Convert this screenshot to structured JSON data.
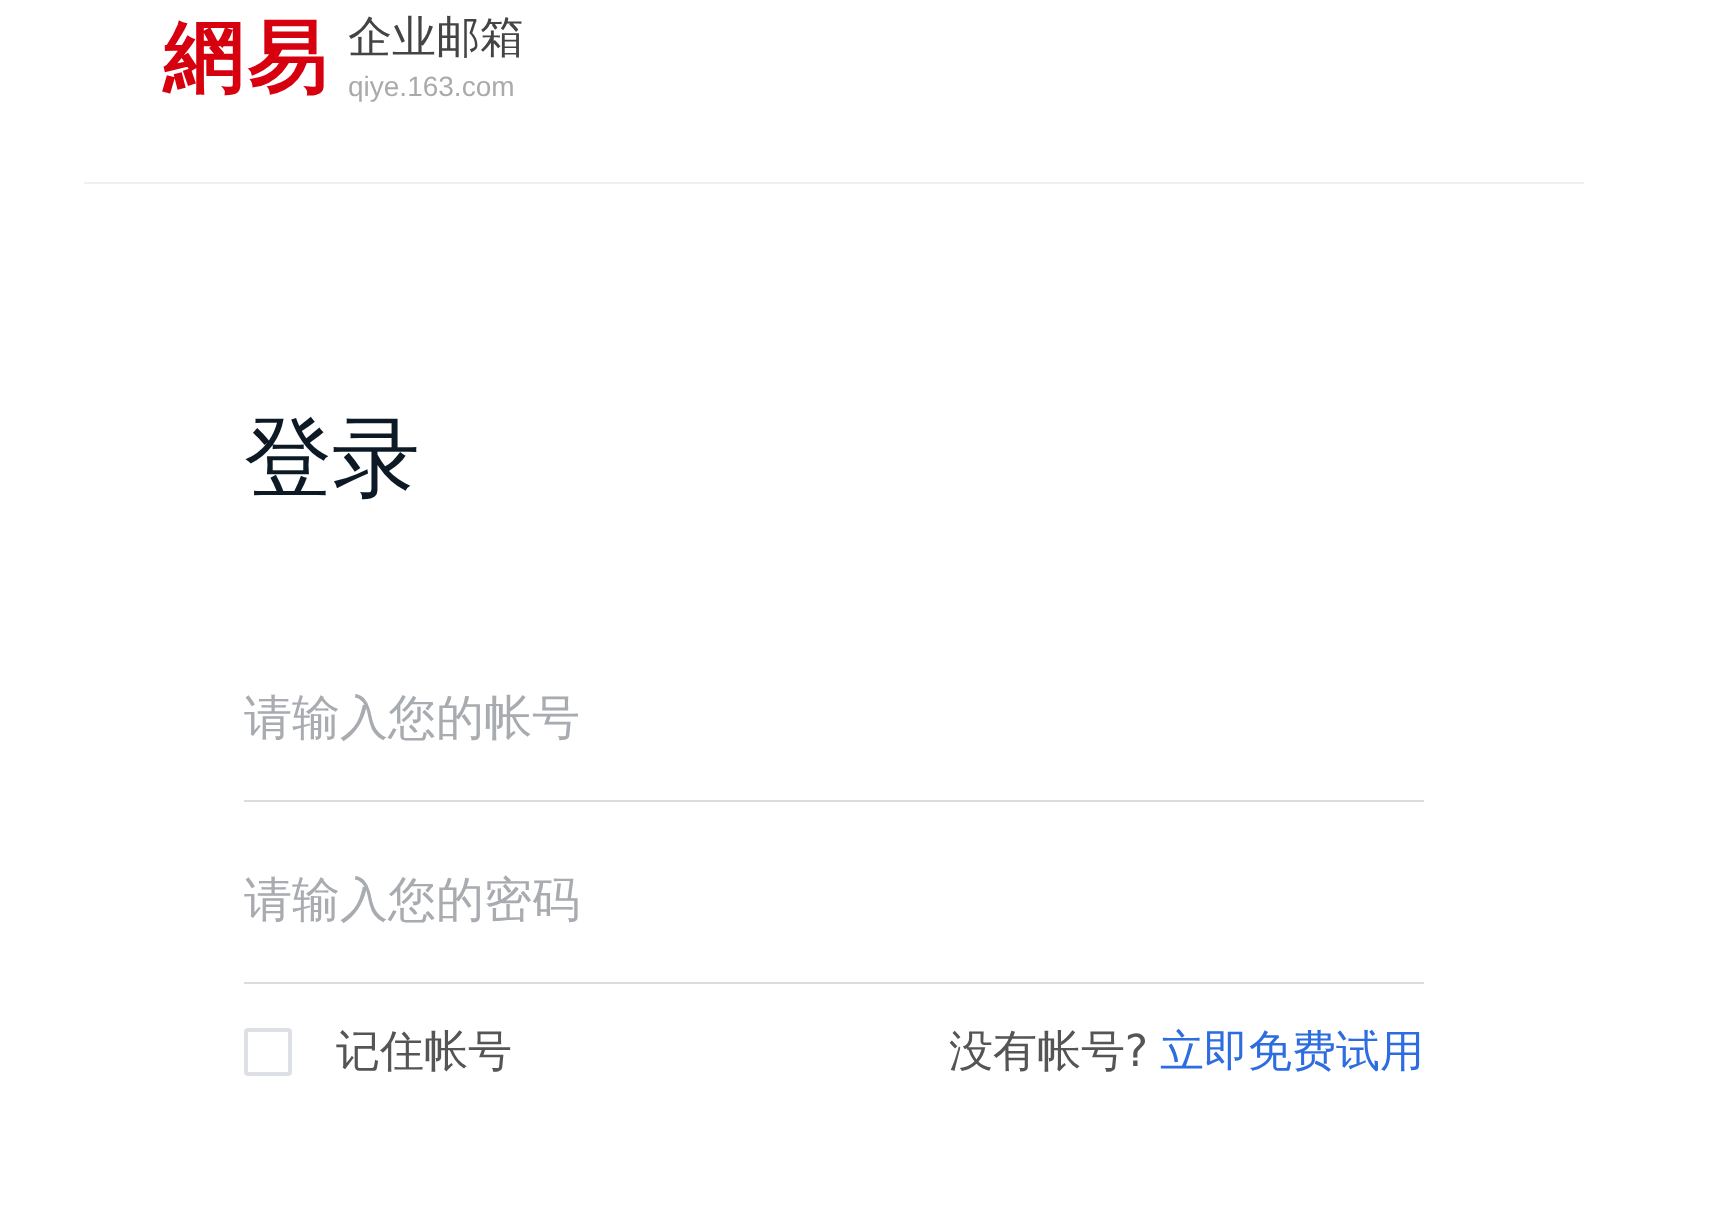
{
  "logo": {
    "mark": "網易",
    "name": "企业邮箱",
    "domain": "qiye.163.com"
  },
  "title": "登录",
  "fields": [
    {
      "placeholder": "请输入您的帐号"
    },
    {
      "placeholder": "请输入您的密码"
    }
  ],
  "remember": {
    "label": "记住帐号",
    "checked": false
  },
  "signup": {
    "prompt": "没有帐号?",
    "link": "立即免费试用"
  }
}
